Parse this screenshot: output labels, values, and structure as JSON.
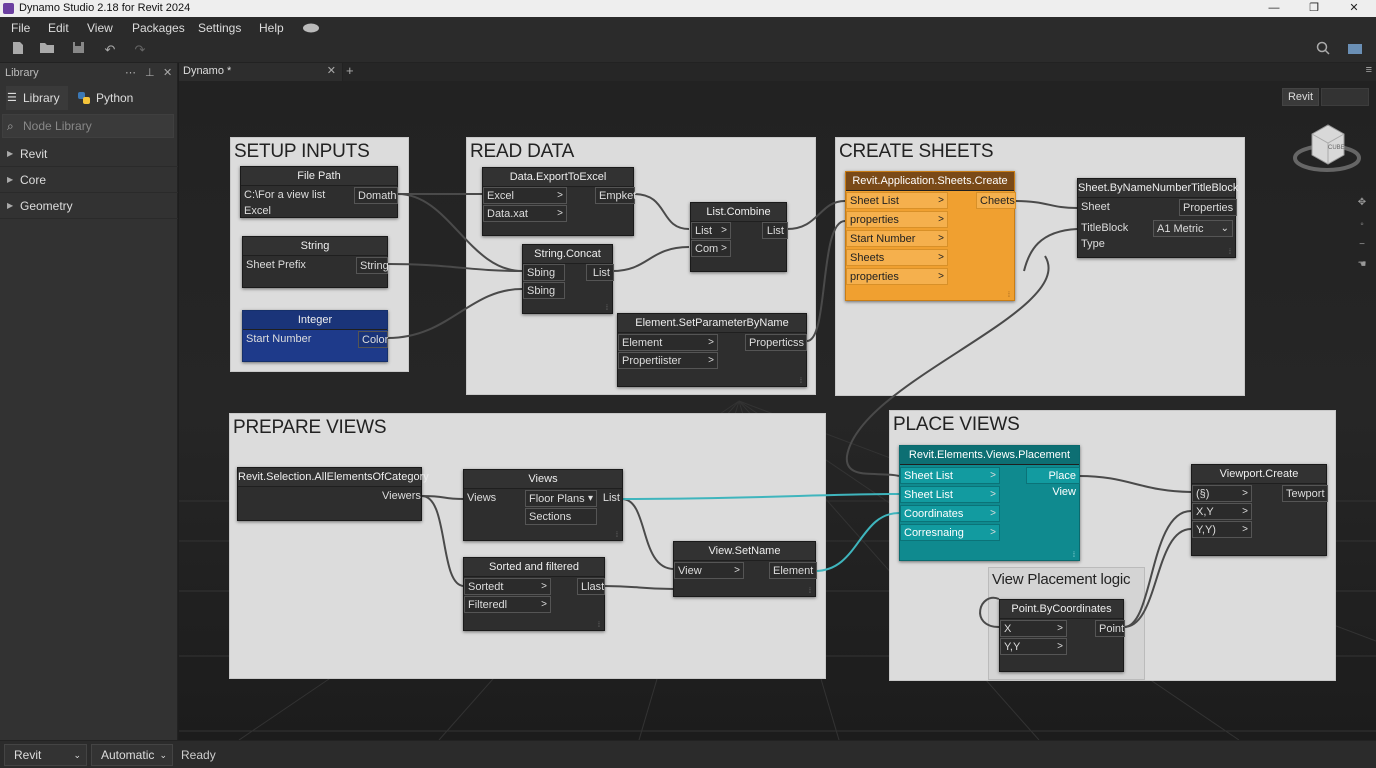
{
  "window": {
    "title": "Dynamo Studio 2.18 for Revit 2024",
    "minimize": "—",
    "maximize": "❐",
    "close": "✕"
  },
  "menu": [
    "File",
    "Edit",
    "View",
    "Packages",
    "Settings",
    "Help"
  ],
  "library": {
    "title": "Library",
    "tabs": [
      "Library",
      "Python"
    ],
    "search_placeholder": "Node Library",
    "categories": [
      "Revit",
      "Core",
      "Geometry"
    ]
  },
  "document": {
    "tab": "Dynamo *",
    "add": "+"
  },
  "canvas": {
    "revit_badge": "Revit",
    "viewcube": "CUBE"
  },
  "groups": {
    "setup_inputs": "SETUP INPUTS",
    "read_data": "READ DATA",
    "create_sheets": "CREATE SHEETS",
    "prepare_views": "PREPARE VIEWS",
    "place_views": "PLACE VIEWS",
    "view_placement_logic": "View Placement logic"
  },
  "nodes": {
    "file_path": {
      "title": "File Path",
      "value": "C:\\For a view list Excel",
      "out": "Domath"
    },
    "string": {
      "title": "String",
      "value": "Sheet Prefix",
      "out": "String"
    },
    "integer": {
      "title": "Integer",
      "value": "Start Number",
      "out": "Color"
    },
    "export_excel": {
      "title": "Data.ExportToExcel",
      "in": [
        "Excel",
        "Data.xat"
      ],
      "out": "Empket"
    },
    "string_concat": {
      "title": "String.Concat",
      "in": [
        "Sbing",
        "Sbing"
      ],
      "out": "List"
    },
    "list_combine": {
      "title": "List.Combine",
      "in": [
        "List",
        "Com"
      ],
      "out": "List"
    },
    "set_param": {
      "title": "Element.SetParameterByName",
      "in": [
        "Element",
        "Propertiister"
      ],
      "out": "Properticss"
    },
    "sheets_create": {
      "title": "Revit.Application.Sheets.Create",
      "in": [
        "Sheet List",
        "properties",
        "Start Number",
        "Sheets",
        "properties"
      ],
      "out": "Cheets"
    },
    "sheet_by_name": {
      "title": "Sheet.ByNameNumberTitleBlock",
      "in": [
        "Sheet",
        "TitleBlock Type"
      ],
      "out": "Properties",
      "dropdown": "A1 Metric"
    },
    "all_elements": {
      "title": "Revit.Selection.AllElementsOfCategory",
      "out": "Viewers"
    },
    "views": {
      "title": "Views",
      "in": "Views",
      "options": [
        "Floor Plans",
        "Sections"
      ],
      "out": "List"
    },
    "sorted": {
      "title": "Sorted and filtered",
      "in": [
        "Sortedt",
        "Filteredl"
      ],
      "out": "Llast"
    },
    "set_name": {
      "title": "View.SetName",
      "in": "View",
      "out": "Element"
    },
    "placement": {
      "title": "Revit.Elements.Views.Placement",
      "in": [
        "Sheet List",
        "Sheet List",
        "Coordinates",
        "Corresnaing"
      ],
      "out": "Place View"
    },
    "viewport": {
      "title": "Viewport.Create",
      "in": [
        "(§)",
        "X,Y",
        "Y,Y)"
      ],
      "out": "Tewport"
    },
    "point": {
      "title": "Point.ByCoordinates",
      "in": [
        "X",
        "Y,Y"
      ],
      "out": "Point"
    }
  },
  "status": {
    "mode": "Revit",
    "run": "Automatic",
    "text": "Ready"
  },
  "colors": {
    "orange": "#f0a030",
    "teal": "#0f8a8f",
    "blue": "#1e3a8a"
  }
}
